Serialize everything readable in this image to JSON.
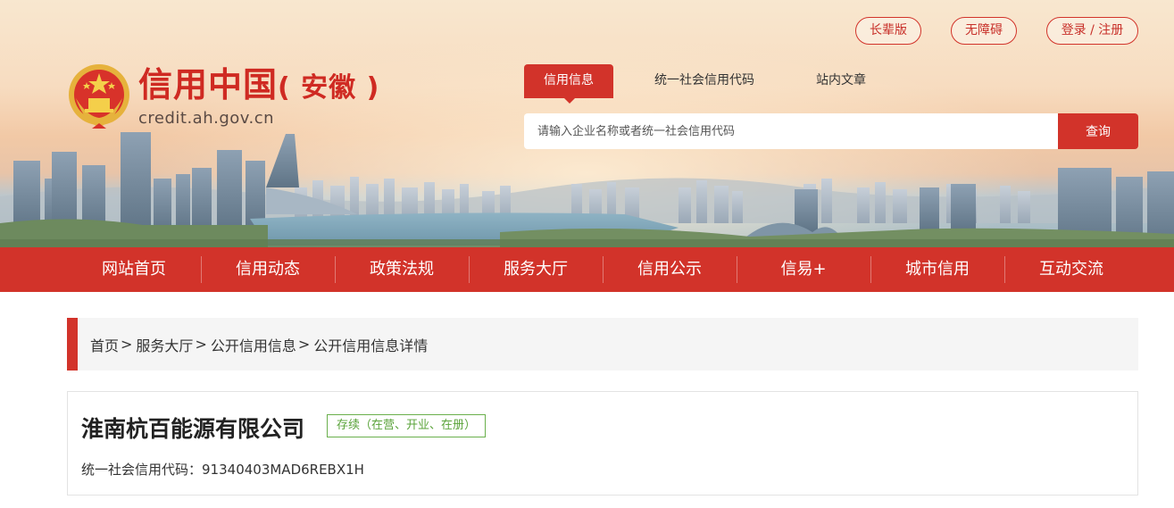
{
  "header": {
    "top_buttons": [
      "长辈版",
      "无障碍",
      "登录 / 注册"
    ],
    "logo_title": "信用中国",
    "logo_province": "( 安徽 )",
    "logo_url": "credit.ah.gov.cn",
    "search_tabs": [
      "信用信息",
      "统一社会信用代码",
      "站内文章"
    ],
    "search_placeholder": "请输入企业名称或者统一社会信用代码",
    "search_button": "查询"
  },
  "nav": {
    "items": [
      "网站首页",
      "信用动态",
      "政策法规",
      "服务大厅",
      "信用公示",
      "信易+",
      "城市信用",
      "互动交流"
    ]
  },
  "breadcrumb": {
    "items": [
      "首页",
      "服务大厅",
      "公开信用信息",
      "公开信用信息详情"
    ],
    "separator": ">"
  },
  "company": {
    "name": "淮南杭百能源有限公司",
    "status": "存续（在营、开业、在册）",
    "credit_code_label": "统一社会信用代码：",
    "credit_code": "91340403MAD6REBX1H"
  },
  "colors": {
    "brand_red": "#d2332a",
    "status_green": "#5aa33a"
  }
}
